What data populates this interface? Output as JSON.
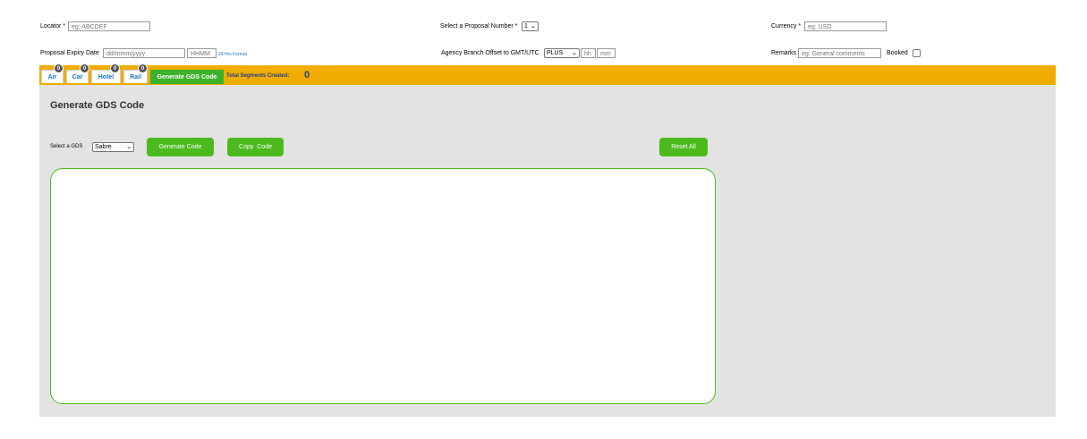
{
  "form": {
    "locator_label": "Locator *",
    "locator_placeholder": "eg; ABCDEF",
    "proposal_number_label": "Select a Proposal Number *",
    "proposal_number_value": "1",
    "currency_label": "Currency *",
    "currency_placeholder": "eg: USD",
    "expiry_label": "Proposal Expiry Date",
    "expiry_date_placeholder": "dd/mmm/yyyy",
    "expiry_time_placeholder": "HHMM",
    "hrs_format_link": "24 Hrs Format",
    "offset_label": "Agency Branch Offset to GMT/UTC",
    "offset_sign_value": "PLUS",
    "offset_hh_placeholder": "hh",
    "offset_mm_placeholder": "mm",
    "remarks_label": "Remarks",
    "remarks_placeholder": "eg: General comments",
    "booked_label": "Booked"
  },
  "tabs": [
    {
      "label": "Air",
      "count": "0"
    },
    {
      "label": "Car",
      "count": "0"
    },
    {
      "label": "Hotel",
      "count": "0"
    },
    {
      "label": "Rail",
      "count": "0"
    }
  ],
  "active_tab": "Generate GDS Code",
  "segments": {
    "label": "Total Segments Created:",
    "count": "0"
  },
  "panel": {
    "title": "Generate GDS Code",
    "gds_label": "Select a GDS",
    "gds_value": "Sabre",
    "generate_button": "Generate Code",
    "copy_button": "Copy  Code",
    "reset_button": "Reset All",
    "code_text": ""
  },
  "colors": {
    "tabbar": "#f0ad00",
    "panel": "#e3e3e3",
    "accent_green": "#4cba1e",
    "link_blue": "#1a73c9"
  }
}
